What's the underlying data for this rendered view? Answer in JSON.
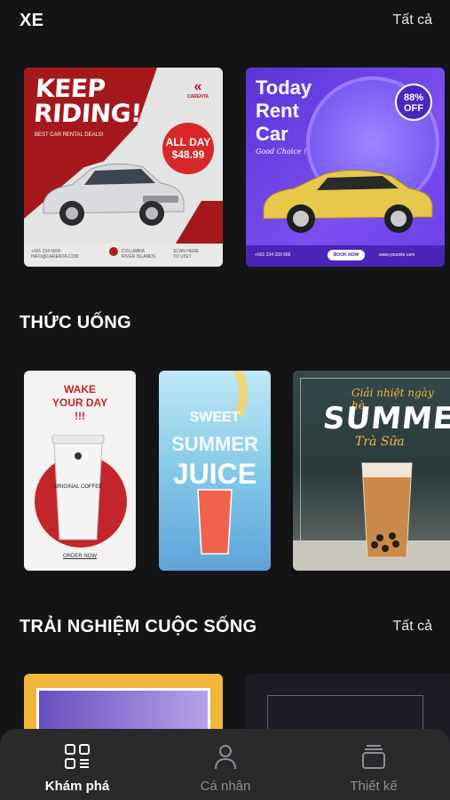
{
  "sections": {
    "cars": {
      "title": "XE",
      "see_all": "Tất cả"
    },
    "drinks": {
      "title": "THỨC UỐNG"
    },
    "life": {
      "title": "TRẢI NGHIỆM CUỘC SỐNG",
      "see_all": "Tất cả"
    }
  },
  "cards": {
    "car1": {
      "headline_1": "KEEP",
      "headline_2": "RIDING!",
      "subtitle": "BEST CAR RENTAL DEALS!",
      "brand": "CARENTA",
      "badge_1": "ALL DAY",
      "badge_2": "$48.99"
    },
    "car2": {
      "headline_1": "Today",
      "headline_2": "Rent",
      "headline_3": "Car",
      "tagline": "Good Choice !",
      "discount_1": "88%",
      "discount_2": "OFF",
      "phone": "+001 234 333 666",
      "cta": "BOOK NOW",
      "site": "www.yoursite.com"
    },
    "drink1": {
      "headline_1": "WAKE",
      "headline_2": "YOUR DAY",
      "headline_3": "!!!",
      "cup_text": "ORIGINAL COFFEE",
      "order": "ORDER NOW"
    },
    "drink2": {
      "line1": "SWEET",
      "line2": "SUMMER",
      "line3": "JUICE"
    },
    "drink3": {
      "subtitle": "Giải nhiệt ngày hè",
      "title": "SUMMER",
      "script": "Trà Sữa"
    }
  },
  "bottom_nav": [
    {
      "label": "Khám phá",
      "icon": "explore-grid-icon",
      "active": true
    },
    {
      "label": "Cá nhân",
      "icon": "person-icon",
      "active": false
    },
    {
      "label": "Thiết kế",
      "icon": "layers-icon",
      "active": false
    }
  ],
  "colors": {
    "background": "#141416",
    "nav_background": "#2a2a2d",
    "inactive": "#8e8e93"
  }
}
